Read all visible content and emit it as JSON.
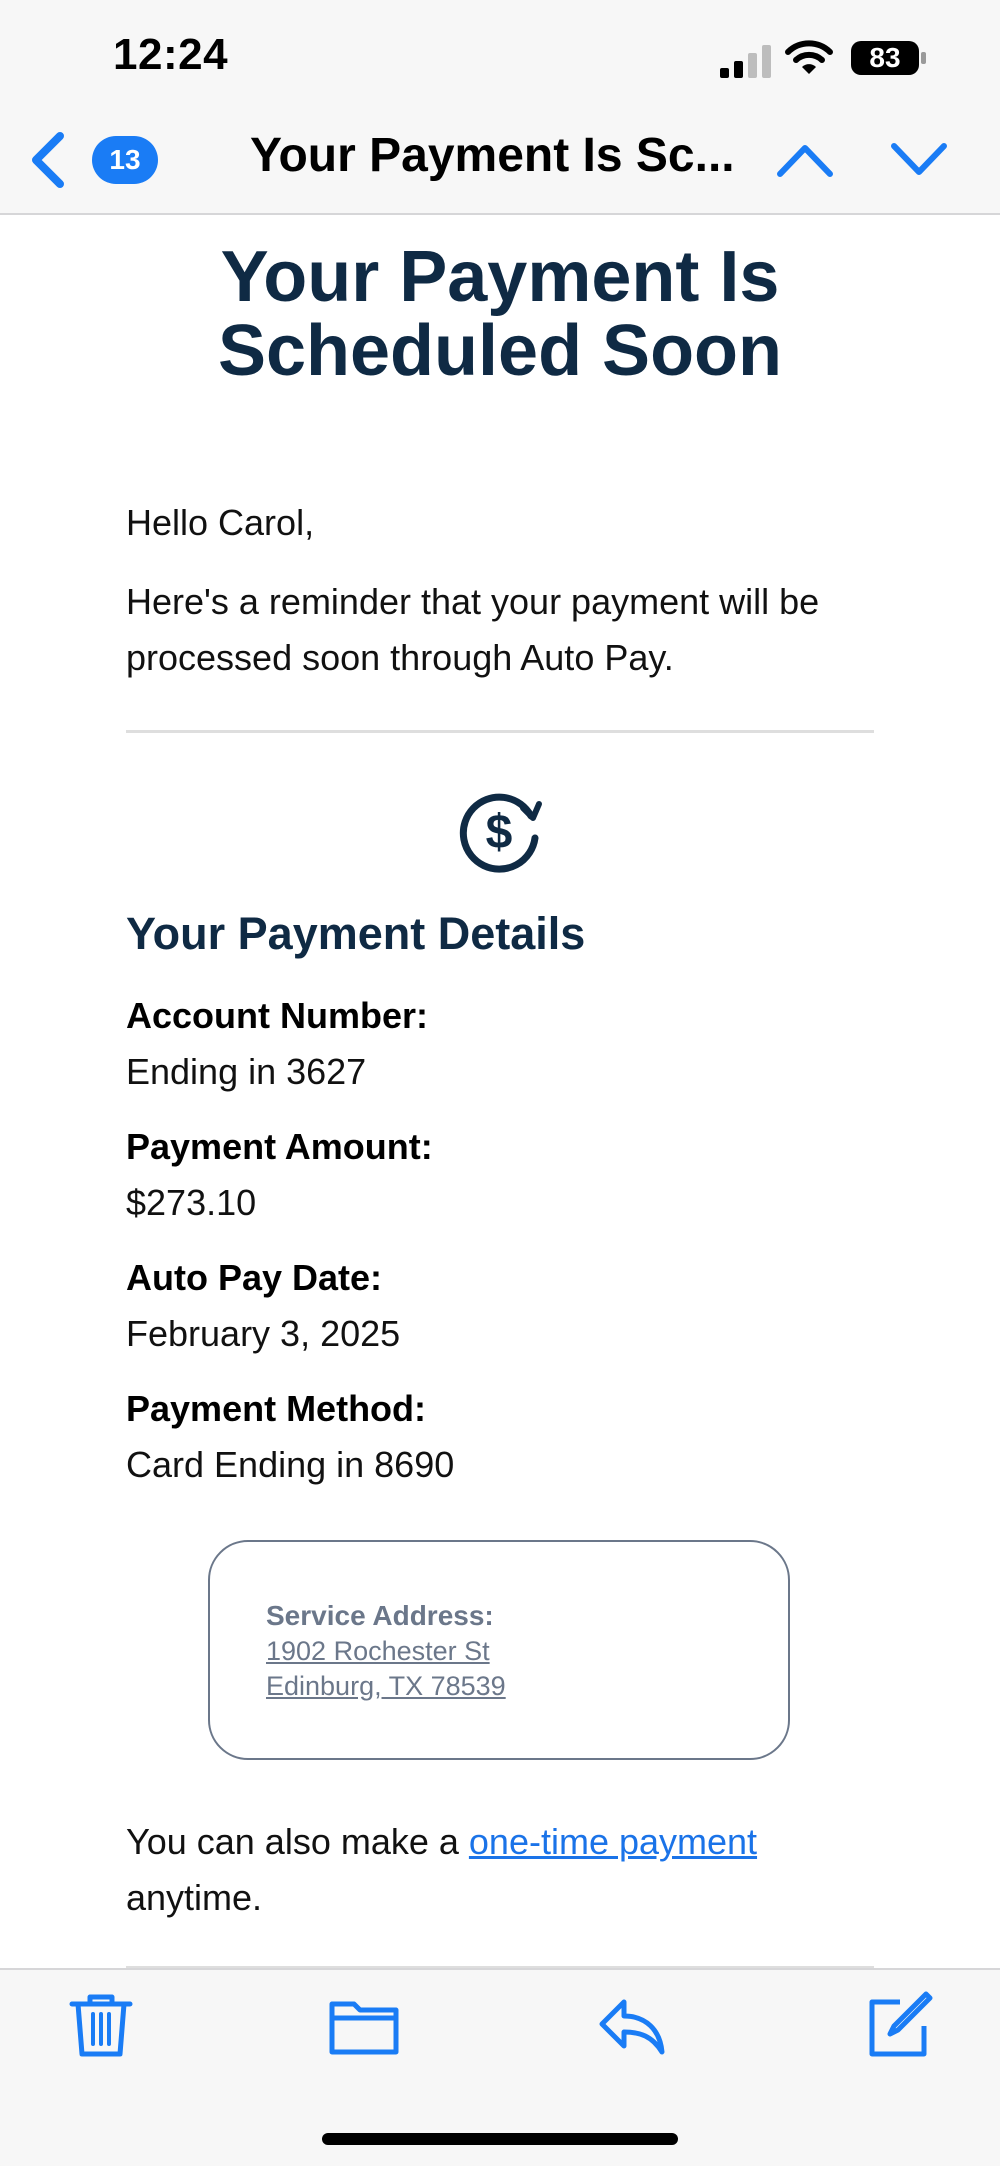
{
  "status": {
    "time": "12:24",
    "battery": "83"
  },
  "nav": {
    "badge": "13",
    "title": "Your Payment Is Sc..."
  },
  "email": {
    "heading_line1": "Your Payment Is",
    "heading_line2": "Scheduled Soon",
    "greeting": "Hello Carol,",
    "intro": "Here's a reminder that your payment will be processed soon through Auto Pay.",
    "details_title": "Your Payment Details",
    "details": [
      {
        "label": "Account Number:",
        "value": "Ending in 3627"
      },
      {
        "label": "Payment Amount:",
        "value": "$273.10"
      },
      {
        "label": "Auto Pay Date:",
        "value": "February 3, 2025"
      },
      {
        "label": "Payment Method:",
        "value": "Card Ending in 8690"
      }
    ],
    "service_address_label": "Service Address:",
    "service_address_line1": "1902 Rochester St",
    "service_address_line2": "Edinburg, TX 78539",
    "onetime_prefix": "You can also make a ",
    "onetime_link": "one-time payment",
    "onetime_suffix": "anytime."
  },
  "icons": {
    "back": "chevron-left-icon",
    "prev": "chevron-up-icon",
    "next": "chevron-down-icon",
    "payment": "dollar-refresh-icon",
    "trash": "trash-icon",
    "folder": "folder-icon",
    "reply": "reply-icon",
    "compose": "compose-icon"
  },
  "colors": {
    "accent": "#1a7cf5",
    "heading": "#0f2a44",
    "link": "#1a73e8",
    "muted": "#6b778a"
  }
}
